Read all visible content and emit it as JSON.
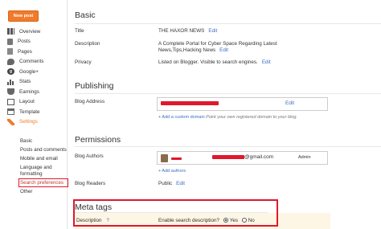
{
  "sidebar": {
    "new_post": "New post",
    "items": [
      {
        "label": "Overview",
        "icon": "overview-icon"
      },
      {
        "label": "Posts",
        "icon": "posts-icon"
      },
      {
        "label": "Pages",
        "icon": "pages-icon"
      },
      {
        "label": "Comments",
        "icon": "comments-icon"
      },
      {
        "label": "Google+",
        "icon": "google-plus-icon"
      },
      {
        "label": "Stats",
        "icon": "stats-icon"
      },
      {
        "label": "Earnings",
        "icon": "earnings-icon"
      },
      {
        "label": "Layout",
        "icon": "layout-icon"
      },
      {
        "label": "Template",
        "icon": "template-icon"
      },
      {
        "label": "Settings",
        "icon": "settings-icon"
      }
    ],
    "settings_sub": [
      "Basic",
      "Posts and comments",
      "Mobile and email",
      "Language and formatting",
      "Search preferences",
      "Other"
    ]
  },
  "basic": {
    "heading": "Basic",
    "title_label": "Title",
    "title_value": "THE HAXOR NEWS",
    "description_label": "Description",
    "description_value": "A Complete Portal for Cyber Space Regarding Latest News,Tips,Hacking News",
    "privacy_label": "Privacy",
    "privacy_value": "Listed on Blogger. Visible to search engines.",
    "edit": "Edit"
  },
  "publishing": {
    "heading": "Publishing",
    "address_label": "Blog Address",
    "edit": "Edit",
    "add_domain": "+ Add a custom domain",
    "domain_hint": "Point your own registered domain to your blog."
  },
  "permissions": {
    "heading": "Permissions",
    "authors_label": "Blog Authors",
    "author_email_suffix": "@gmail.com",
    "author_role": "Admin",
    "add_authors": "+ Add authors",
    "readers_label": "Blog Readers",
    "readers_value": "Public",
    "edit": "Edit"
  },
  "meta": {
    "heading": "Meta tags",
    "description_label": "Description",
    "help": "?",
    "question": "Enable search description?",
    "yes": "Yes",
    "no": "No",
    "selected": "Yes"
  },
  "colors": {
    "accent": "#f07b2a",
    "link": "#3b6fc0",
    "highlight": "#e0182d"
  }
}
